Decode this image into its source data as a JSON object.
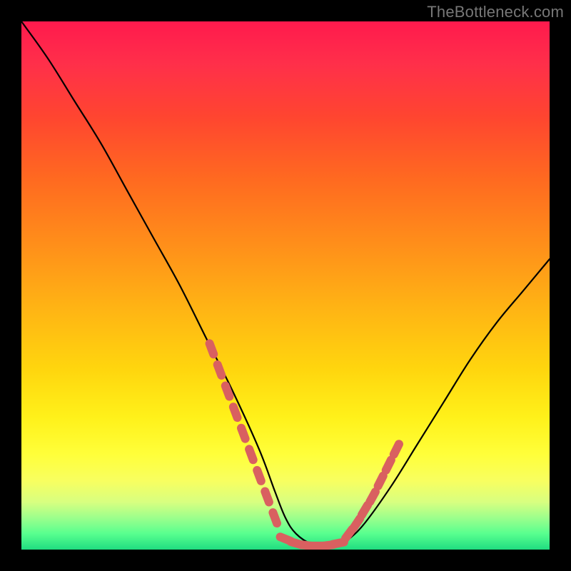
{
  "watermark": "TheBottleneck.com",
  "chart_data": {
    "type": "line",
    "title": "",
    "xlabel": "",
    "ylabel": "",
    "xlim": [
      0,
      100
    ],
    "ylim": [
      0,
      100
    ],
    "grid": false,
    "legend": "none",
    "series": [
      {
        "name": "bottleneck-curve",
        "x": [
          0,
          5,
          10,
          15,
          20,
          25,
          30,
          35,
          40,
          45,
          48,
          50,
          52,
          55,
          58,
          60,
          62,
          65,
          70,
          75,
          80,
          85,
          90,
          95,
          100
        ],
        "values": [
          100,
          93,
          85,
          77,
          68,
          59,
          50,
          40,
          30,
          19,
          11,
          6,
          3,
          1,
          0.5,
          0.8,
          2,
          5,
          12,
          20,
          28,
          36,
          43,
          49,
          55
        ]
      }
    ],
    "markers": [
      {
        "name": "left-segment-markers",
        "x": [
          36,
          37.5,
          39,
          40.5,
          42,
          43.5,
          45,
          46.5,
          48
        ],
        "values": [
          38,
          34,
          30,
          26,
          22,
          18,
          14,
          10,
          6
        ]
      },
      {
        "name": "valley-markers",
        "x": [
          50,
          52,
          54,
          56,
          58,
          60
        ],
        "values": [
          2,
          1.2,
          0.8,
          0.7,
          0.8,
          1.2
        ]
      },
      {
        "name": "right-segment-markers",
        "x": [
          62,
          63.5,
          65,
          66.5,
          68,
          69.5,
          71
        ],
        "values": [
          3,
          5,
          7.5,
          10,
          13,
          16,
          19
        ]
      }
    ],
    "background_gradient": {
      "top": "#ff1a4d",
      "upper_mid": "#ff8e1a",
      "mid": "#ffff3a",
      "bottom": "#20dd80"
    },
    "marker_color": "#d96060",
    "curve_color": "#000000"
  }
}
